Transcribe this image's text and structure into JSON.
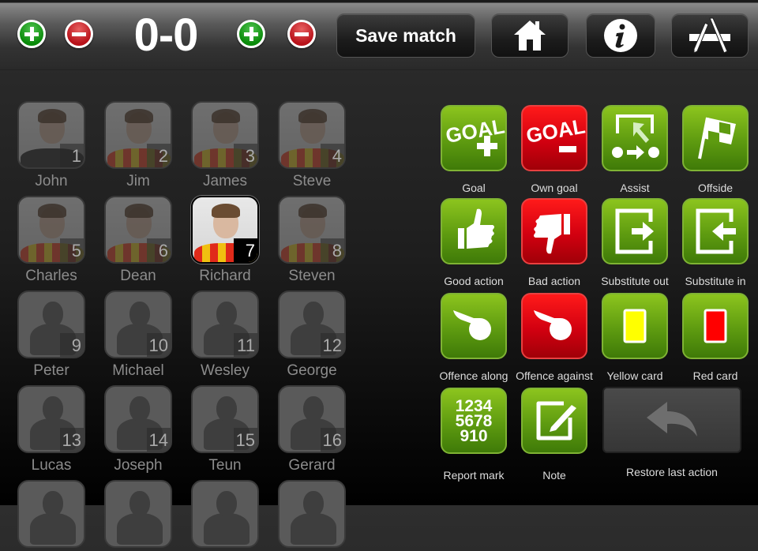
{
  "topbar": {
    "home_score": "0",
    "separator": "-",
    "away_score": "0",
    "save_label": "Save match",
    "home_icon": "home-icon",
    "info_icon": "info-icon",
    "appstore_icon": "app-store-icon"
  },
  "players": [
    {
      "name": "John",
      "number": "1",
      "photo": true,
      "shirt": "dark"
    },
    {
      "name": "Jim",
      "number": "2",
      "photo": true
    },
    {
      "name": "James",
      "number": "3",
      "photo": true
    },
    {
      "name": "Steve",
      "number": "4",
      "photo": true
    },
    {
      "name": "Charles",
      "number": "5",
      "photo": true
    },
    {
      "name": "Dean",
      "number": "6",
      "photo": true
    },
    {
      "name": "Richard",
      "number": "7",
      "photo": true,
      "selected": true
    },
    {
      "name": "Steven",
      "number": "8",
      "photo": true
    },
    {
      "name": "Peter",
      "number": "9"
    },
    {
      "name": "Michael",
      "number": "10"
    },
    {
      "name": "Wesley",
      "number": "11"
    },
    {
      "name": "George",
      "number": "12"
    },
    {
      "name": "Lucas",
      "number": "13"
    },
    {
      "name": "Joseph",
      "number": "14"
    },
    {
      "name": "Teun",
      "number": "15"
    },
    {
      "name": "Gerard",
      "number": "16"
    },
    {
      "name": "",
      "number": ""
    },
    {
      "name": "",
      "number": ""
    },
    {
      "name": "",
      "number": ""
    },
    {
      "name": "",
      "number": ""
    }
  ],
  "actions": [
    {
      "label": "Goal",
      "color": "green",
      "icon": "goal-plus-icon"
    },
    {
      "label": "Own goal",
      "color": "red",
      "icon": "goal-minus-icon"
    },
    {
      "label": "Assist",
      "color": "green",
      "icon": "assist-icon"
    },
    {
      "label": "Offside",
      "color": "green",
      "icon": "offside-flag-icon"
    },
    {
      "label": "Good action",
      "color": "green",
      "icon": "thumbs-up-icon"
    },
    {
      "label": "Bad action",
      "color": "red",
      "icon": "thumbs-down-icon"
    },
    {
      "label": "Substitute out",
      "color": "green",
      "icon": "substitute-out-icon"
    },
    {
      "label": "Substitute in",
      "color": "green",
      "icon": "substitute-in-icon"
    },
    {
      "label": "Offence along",
      "color": "green",
      "icon": "whistle-icon"
    },
    {
      "label": "Offence against",
      "color": "red",
      "icon": "whistle-icon"
    },
    {
      "label": "Yellow card",
      "color": "green",
      "icon": "yellow-card-icon"
    },
    {
      "label": "Red card",
      "color": "green",
      "icon": "red-card-icon"
    },
    {
      "label": "Report mark",
      "color": "green",
      "icon": "report-mark-icon",
      "text": [
        "1234",
        "5678",
        "910"
      ]
    },
    {
      "label": "Note",
      "color": "green",
      "icon": "note-edit-icon"
    }
  ],
  "restore": {
    "label": "Restore last action",
    "icon": "undo-arrow-icon"
  },
  "colors": {
    "green": "#5e9b10",
    "red": "#d20010",
    "yellow_card": "#ffff00",
    "red_card": "#ff0000"
  }
}
